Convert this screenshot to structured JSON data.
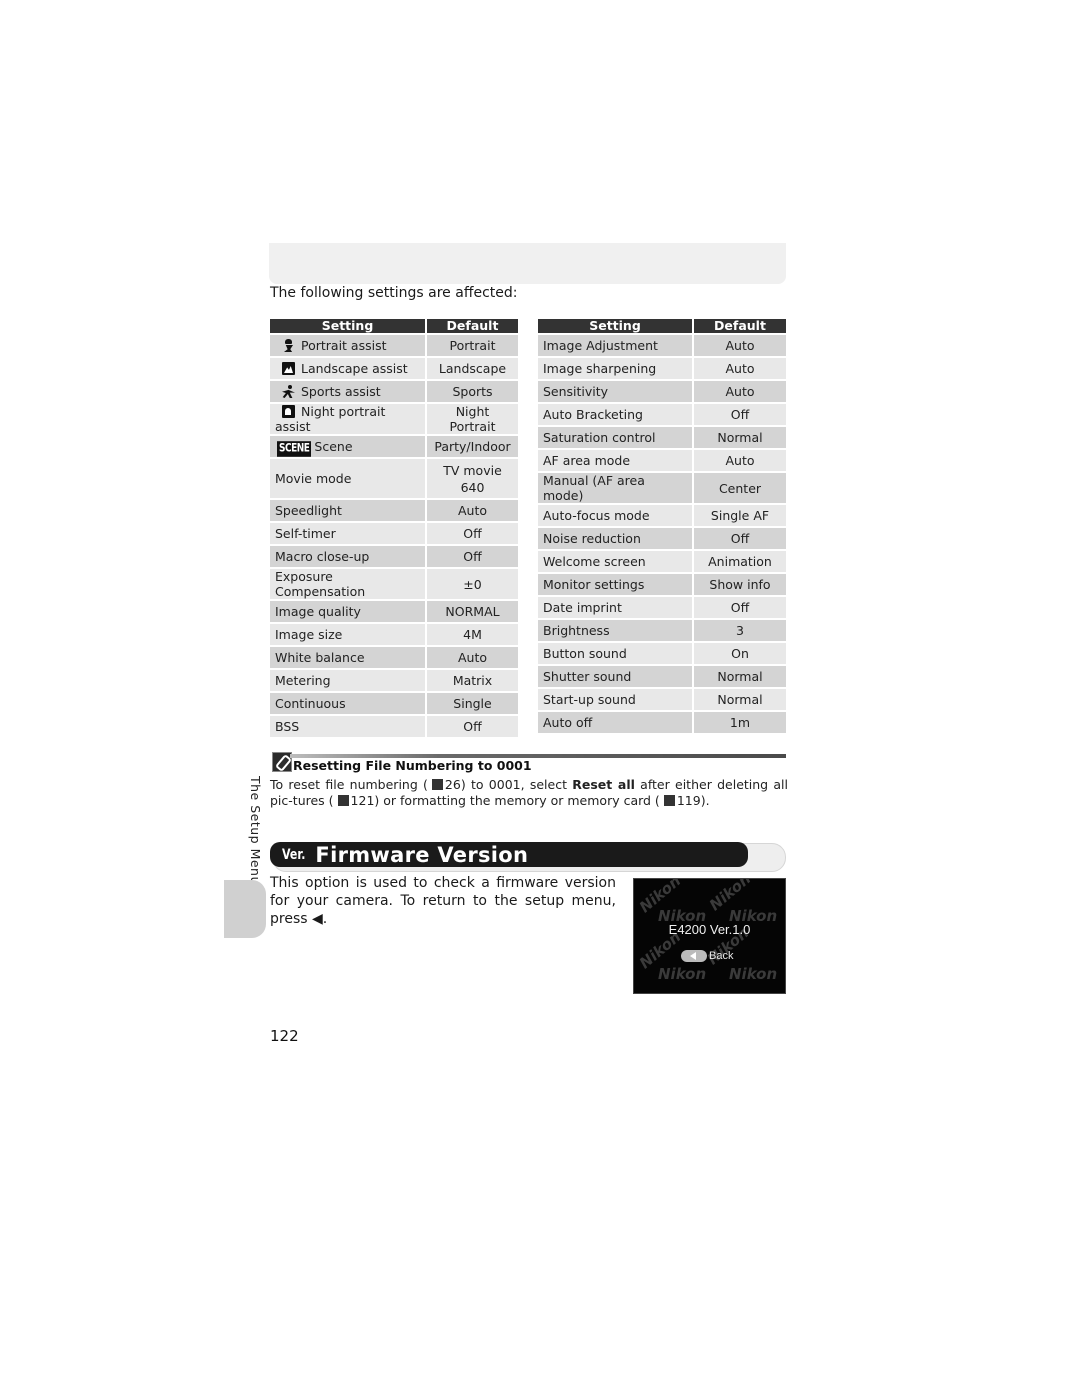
{
  "intro_text": "The following settings are affected:",
  "table_left": {
    "headers": [
      "Setting",
      "Default"
    ],
    "rows": [
      {
        "icon": "portrait-assist-icon",
        "setting": "Portrait assist",
        "default": "Portrait"
      },
      {
        "icon": "landscape-assist-icon",
        "setting": "Landscape assist",
        "default": "Landscape"
      },
      {
        "icon": "sports-assist-icon",
        "setting": "Sports assist",
        "default": "Sports"
      },
      {
        "icon": "night-portrait-assist-icon",
        "setting": "Night portrait assist",
        "default": "Night Portrait"
      },
      {
        "icon": "scene-icon",
        "badge": "SCENE",
        "setting": "Scene",
        "default": "Party/Indoor"
      },
      {
        "setting": "Movie mode",
        "default_line1": "TV movie",
        "default_line2": "640"
      },
      {
        "setting": "Speedlight",
        "default": "Auto"
      },
      {
        "setting": "Self-timer",
        "default": "Off"
      },
      {
        "setting": "Macro close-up",
        "default": "Off"
      },
      {
        "setting": "Exposure Compensation",
        "default": "±0"
      },
      {
        "setting": "Image quality",
        "default": "NORMAL"
      },
      {
        "setting": "Image size",
        "default": "4M"
      },
      {
        "setting": "White balance",
        "default": "Auto"
      },
      {
        "setting": "Metering",
        "default": "Matrix"
      },
      {
        "setting": "Continuous",
        "default": "Single"
      },
      {
        "setting": "BSS",
        "default": "Off"
      }
    ]
  },
  "table_right": {
    "headers": [
      "Setting",
      "Default"
    ],
    "rows": [
      {
        "setting": "Image Adjustment",
        "default": "Auto"
      },
      {
        "setting": "Image sharpening",
        "default": "Auto"
      },
      {
        "setting": "Sensitivity",
        "default": "Auto"
      },
      {
        "setting": "Auto Bracketing",
        "default": "Off"
      },
      {
        "setting": "Saturation control",
        "default": "Normal"
      },
      {
        "setting": "AF area mode",
        "default": "Auto"
      },
      {
        "setting": "Manual (AF area mode)",
        "default": "Center"
      },
      {
        "setting": "Auto-focus mode",
        "default": "Single AF"
      },
      {
        "setting": "Noise reduction",
        "default": "Off"
      },
      {
        "setting": "Welcome screen",
        "default": "Animation"
      },
      {
        "setting": "Monitor settings",
        "default": "Show info"
      },
      {
        "setting": "Date imprint",
        "default": "Off"
      },
      {
        "setting": "Brightness",
        "default": "3"
      },
      {
        "setting": "Button sound",
        "default": "On"
      },
      {
        "setting": "Shutter sound",
        "default": "Normal"
      },
      {
        "setting": "Start-up sound",
        "default": "Normal"
      },
      {
        "setting": "Auto off",
        "default": "1m"
      }
    ]
  },
  "note": {
    "title": "Resetting File Numbering to 0001",
    "p1": "To reset file numbering (",
    "ref1": "26",
    "p2": ") to 0001, select ",
    "bold": "Reset all",
    "p3": " after either deleting all pic-tures (",
    "ref2": "121",
    "p4": ") or formatting the memory or memory card (",
    "ref3": "119",
    "p5": ")."
  },
  "side_label": "The Setup Menu",
  "section": {
    "badge": "Ver.",
    "title": "Firmware Version",
    "text": "This option is used to check a firmware version for your camera. To return to the setup menu, press ◀."
  },
  "camera_screen": {
    "watermark": "Nikon",
    "version_text": "E4200 Ver.1.0",
    "back_label": "Back"
  },
  "page_number": "122"
}
